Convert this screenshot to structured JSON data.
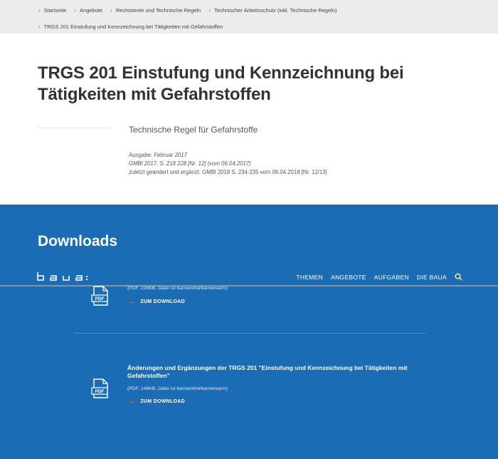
{
  "breadcrumb": {
    "items": [
      "Startseite",
      "Angebote",
      "Rechtstexte und Technische Regeln",
      "Technischer Arbeitsschutz (inkl. Technische Regeln)"
    ],
    "current": "TRGS 201 Einstufung und Kennzeichnung bei Tätigkeiten mit Gefahrstoffen"
  },
  "page": {
    "title": "TRGS 201 Einstufung und Kennzeichnung bei Tätigkeiten mit Gefahrstoffen",
    "subtitle": "Technische Regel für Gefahrstoffe",
    "meta": {
      "ausgabe": "Ausgabe: Februar 2017",
      "gmbl": "GMBl 2017, S. 218 228 [Nr. 12] (vom 06.04.2017)",
      "changed": "zuletzt geändert und ergänzt: GMBl 2018 S. 234-235 vom 06.04.2018 [Nr. 12/13]"
    }
  },
  "nav": {
    "logo_text": "baua:",
    "items": [
      "THEMEN",
      "ANGEBOTE",
      "AUFGABEN",
      "DIE BAUA"
    ],
    "search_icon": "search-icon"
  },
  "downloads": {
    "heading": "Downloads",
    "items": [
      {
        "title": "",
        "meta": "(PDF, 228KB, Datei ist barrierefrei⁄barrierearm)",
        "link": "ZUM DOWNLOAD",
        "icon": "pdf-icon",
        "icon_label": "PDF"
      },
      {
        "title": "Änderungen und Ergänzungen der TRGS 201 \"Einstufung und Kennzeichnung bei Tätigkeiten mit Gefahrstoffen\"",
        "meta": "(PDF, 148KB, Datei ist barrierefrei⁄barrierearm)",
        "link": "ZUM DOWNLOAD",
        "icon": "pdf-icon",
        "icon_label": "PDF"
      }
    ]
  },
  "colors": {
    "blue": "#1a6db5",
    "breadcrumb_bg": "#ececec",
    "arrow": "#f07a3a"
  }
}
